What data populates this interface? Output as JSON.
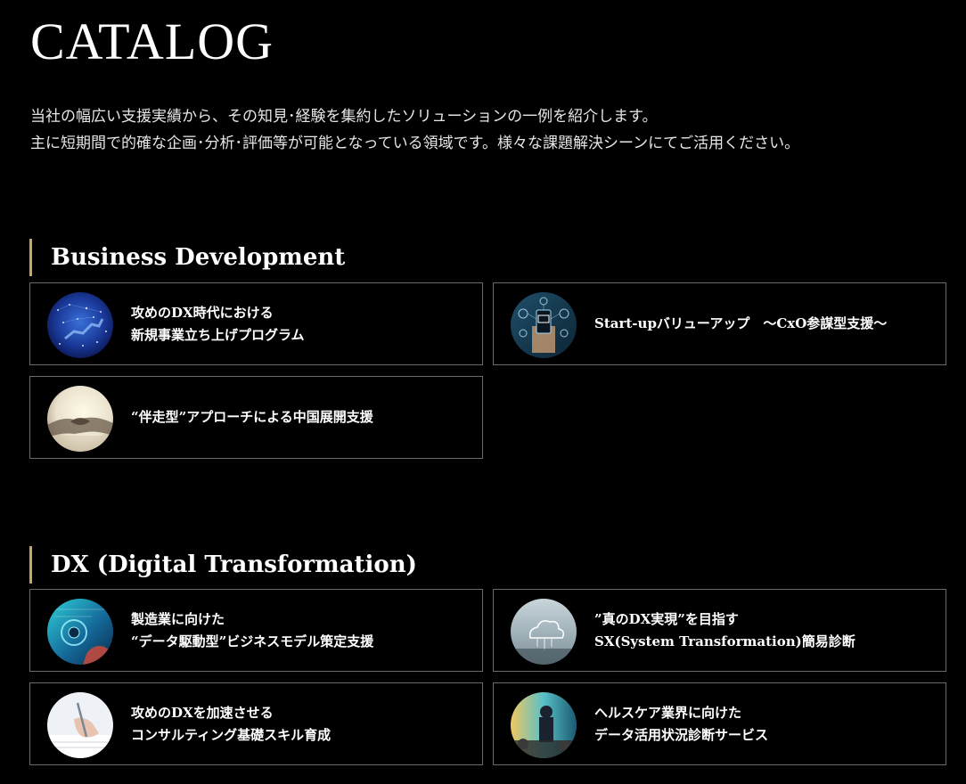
{
  "page": {
    "title": "CATALOG",
    "intro": [
      "当社の幅広い支援実績から、その知見･経験を集約したソリューションの一例を紹介します。",
      "主に短期間で的確な企画･分析･評価等が可能となっている領域です。様々な課題解決シーンにてご活用ください。"
    ]
  },
  "colors": {
    "background": "#000000",
    "accent_bar": "#c9a760",
    "card_border": "#6a6a6a",
    "text": "#ffffff"
  },
  "sections": [
    {
      "heading": "Business Development",
      "cards": [
        {
          "lines": [
            "攻めのDX時代における",
            "新規事業立ち上げプログラム"
          ],
          "image": "digital-japan-map-image"
        },
        {
          "lines": [
            "Start-upバリューアップ　～CxO参謀型支援～"
          ],
          "image": "smartphone-network-image"
        },
        {
          "lines": [
            "“伴走型”アプローチによる中国展開支援"
          ],
          "image": "handshake-image"
        }
      ]
    },
    {
      "heading": "DX (Digital Transformation)",
      "cards": [
        {
          "lines": [
            "製造業に向けた",
            "“データ駆動型”ビジネスモデル策定支援"
          ],
          "image": "manufacturing-data-image"
        },
        {
          "lines": [
            "”真のDX実現”を目指す",
            "SX(System Transformation)簡易診断"
          ],
          "image": "cloud-computing-image"
        },
        {
          "lines": [
            "攻めのDXを加速させる",
            "コンサルティング基礎スキル育成"
          ],
          "image": "writing-hand-image"
        },
        {
          "lines": [
            "ヘルスケア業界に向けた",
            "データ活用状況診断サービス"
          ],
          "image": "healthcare-data-image"
        }
      ]
    }
  ]
}
